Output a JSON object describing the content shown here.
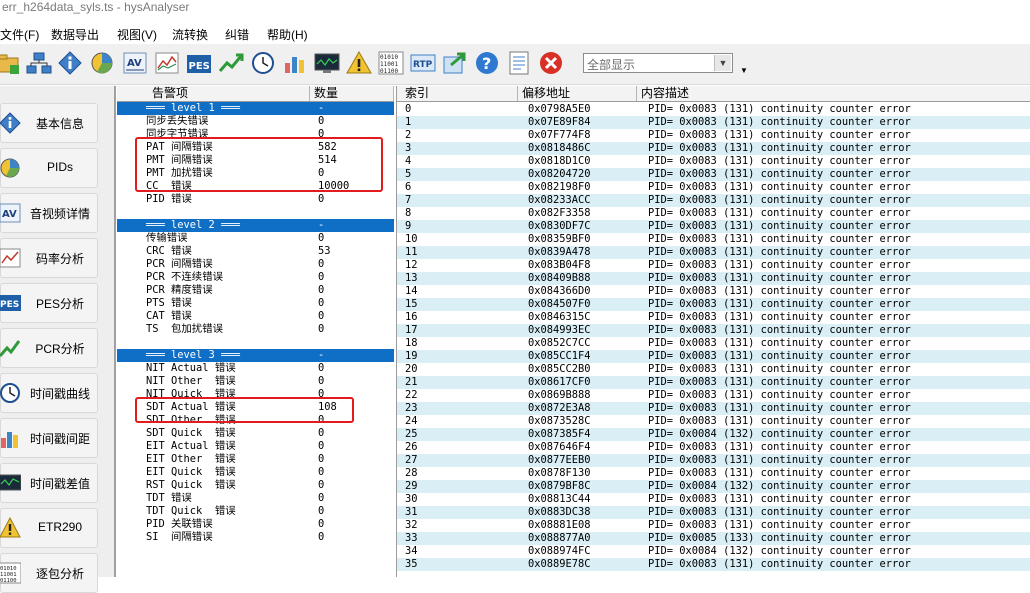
{
  "window": {
    "title": "err_h264data_syls.ts - hysAnalyser"
  },
  "menu": [
    {
      "label": "文件(F)"
    },
    {
      "label": "数据导出"
    },
    {
      "label": "视图(V)"
    },
    {
      "label": "流转换"
    },
    {
      "label": "纠错"
    },
    {
      "label": "帮助(H)"
    }
  ],
  "toolbar": {
    "buttons": [
      {
        "icon": "open-file-icon"
      },
      {
        "icon": "network-icon"
      },
      {
        "icon": "info-icon"
      },
      {
        "icon": "pie-chart-icon"
      },
      {
        "icon": "av-icon"
      },
      {
        "icon": "line-chart-icon"
      },
      {
        "icon": "pes-icon"
      },
      {
        "icon": "pcr-trend-icon"
      },
      {
        "icon": "clock-icon"
      },
      {
        "icon": "bar-chart-icon"
      },
      {
        "icon": "monitor-icon"
      },
      {
        "icon": "warning-icon"
      },
      {
        "icon": "binary-icon"
      },
      {
        "icon": "rtp-icon"
      },
      {
        "icon": "export-icon"
      },
      {
        "icon": "help-icon"
      },
      {
        "icon": "notes-icon"
      },
      {
        "icon": "close-icon"
      }
    ],
    "combo_value": "全部显示"
  },
  "sidebar": [
    {
      "label": "基本信息",
      "icon": "info-icon"
    },
    {
      "label": "PIDs",
      "icon": "pie-chart-icon"
    },
    {
      "label": "音视频详情",
      "icon": "av-icon"
    },
    {
      "label": "码率分析",
      "icon": "line-chart-icon"
    },
    {
      "label": "PES分析",
      "icon": "pes-icon"
    },
    {
      "label": "PCR分析",
      "icon": "pcr-trend-icon"
    },
    {
      "label": "时间戳曲线",
      "icon": "clock-icon"
    },
    {
      "label": "时间戳间距",
      "icon": "bar-chart-icon"
    },
    {
      "label": "时间戳差值",
      "icon": "monitor-icon"
    },
    {
      "label": "ETR290",
      "icon": "warning-icon"
    },
    {
      "label": "逐包分析",
      "icon": "binary-icon"
    }
  ],
  "alarms": {
    "headers": [
      "告警项",
      "数量"
    ],
    "rows": [
      {
        "label": "═══ level 1 ═══",
        "count": "-",
        "level": true
      },
      {
        "label": "同步丢失错误",
        "count": "0"
      },
      {
        "label": "同步字节错误",
        "count": "0"
      },
      {
        "label": "PAT 间隔错误",
        "count": "582"
      },
      {
        "label": "PMT 间隔错误",
        "count": "514"
      },
      {
        "label": "PMT 加扰错误",
        "count": "0"
      },
      {
        "label": "CC  错误",
        "count": "10000"
      },
      {
        "label": "PID 错误",
        "count": "0"
      },
      {
        "label": "",
        "count": ""
      },
      {
        "label": "═══ level 2 ═══",
        "count": "-",
        "level": true
      },
      {
        "label": "传输错误",
        "count": "0"
      },
      {
        "label": "CRC 错误",
        "count": "53"
      },
      {
        "label": "PCR 间隔错误",
        "count": "0"
      },
      {
        "label": "PCR 不连续错误",
        "count": "0"
      },
      {
        "label": "PCR 精度错误",
        "count": "0"
      },
      {
        "label": "PTS 错误",
        "count": "0"
      },
      {
        "label": "CAT 错误",
        "count": "0"
      },
      {
        "label": "TS  包加扰错误",
        "count": "0"
      },
      {
        "label": "",
        "count": ""
      },
      {
        "label": "═══ level 3 ═══",
        "count": "-",
        "level": true
      },
      {
        "label": "NIT Actual 错误",
        "count": "0"
      },
      {
        "label": "NIT Other  错误",
        "count": "0"
      },
      {
        "label": "NIT Quick  错误",
        "count": "0"
      },
      {
        "label": "SDT Actual 错误",
        "count": "108"
      },
      {
        "label": "SDT Other  错误",
        "count": "0"
      },
      {
        "label": "SDT Quick  错误",
        "count": "0"
      },
      {
        "label": "EIT Actual 错误",
        "count": "0"
      },
      {
        "label": "EIT Other  错误",
        "count": "0"
      },
      {
        "label": "EIT Quick  错误",
        "count": "0"
      },
      {
        "label": "RST Quick  错误",
        "count": "0"
      },
      {
        "label": "TDT 错误",
        "count": "0"
      },
      {
        "label": "TDT Quick  错误",
        "count": "0"
      },
      {
        "label": "PID 关联错误",
        "count": "0"
      },
      {
        "label": "SI  间隔错误",
        "count": "0"
      }
    ]
  },
  "detail": {
    "headers": [
      "索引",
      "偏移地址",
      "内容描述"
    ],
    "rows": [
      {
        "idx": "0",
        "off": "0x0798A5E0",
        "desc": "PID= 0x0083 (131) continuity counter error"
      },
      {
        "idx": "1",
        "off": "0x07E89F84",
        "desc": "PID= 0x0083 (131) continuity counter error"
      },
      {
        "idx": "2",
        "off": "0x07F774F8",
        "desc": "PID= 0x0083 (131) continuity counter error"
      },
      {
        "idx": "3",
        "off": "0x0818486C",
        "desc": "PID= 0x0083 (131) continuity counter error"
      },
      {
        "idx": "4",
        "off": "0x0818D1C0",
        "desc": "PID= 0x0083 (131) continuity counter error"
      },
      {
        "idx": "5",
        "off": "0x08204720",
        "desc": "PID= 0x0083 (131) continuity counter error"
      },
      {
        "idx": "6",
        "off": "0x082198F0",
        "desc": "PID= 0x0083 (131) continuity counter error"
      },
      {
        "idx": "7",
        "off": "0x08233ACC",
        "desc": "PID= 0x0083 (131) continuity counter error"
      },
      {
        "idx": "8",
        "off": "0x082F3358",
        "desc": "PID= 0x0083 (131) continuity counter error"
      },
      {
        "idx": "9",
        "off": "0x0830DF7C",
        "desc": "PID= 0x0083 (131) continuity counter error"
      },
      {
        "idx": "10",
        "off": "0x08359BF0",
        "desc": "PID= 0x0083 (131) continuity counter error"
      },
      {
        "idx": "11",
        "off": "0x0839A478",
        "desc": "PID= 0x0083 (131) continuity counter error"
      },
      {
        "idx": "12",
        "off": "0x083B04F8",
        "desc": "PID= 0x0083 (131) continuity counter error"
      },
      {
        "idx": "13",
        "off": "0x08409B88",
        "desc": "PID= 0x0083 (131) continuity counter error"
      },
      {
        "idx": "14",
        "off": "0x084366D0",
        "desc": "PID= 0x0083 (131) continuity counter error"
      },
      {
        "idx": "15",
        "off": "0x084507F0",
        "desc": "PID= 0x0083 (131) continuity counter error"
      },
      {
        "idx": "16",
        "off": "0x0846315C",
        "desc": "PID= 0x0083 (131) continuity counter error"
      },
      {
        "idx": "17",
        "off": "0x084993EC",
        "desc": "PID= 0x0083 (131) continuity counter error"
      },
      {
        "idx": "18",
        "off": "0x0852C7CC",
        "desc": "PID= 0x0083 (131) continuity counter error"
      },
      {
        "idx": "19",
        "off": "0x085CC1F4",
        "desc": "PID= 0x0083 (131) continuity counter error"
      },
      {
        "idx": "20",
        "off": "0x085CC2B0",
        "desc": "PID= 0x0083 (131) continuity counter error"
      },
      {
        "idx": "21",
        "off": "0x08617CF0",
        "desc": "PID= 0x0083 (131) continuity counter error"
      },
      {
        "idx": "22",
        "off": "0x0869B888",
        "desc": "PID= 0x0083 (131) continuity counter error"
      },
      {
        "idx": "23",
        "off": "0x0872E3A8",
        "desc": "PID= 0x0083 (131) continuity counter error"
      },
      {
        "idx": "24",
        "off": "0x0873528C",
        "desc": "PID= 0x0083 (131) continuity counter error"
      },
      {
        "idx": "25",
        "off": "0x087385F4",
        "desc": "PID= 0x0084 (132) continuity counter error"
      },
      {
        "idx": "26",
        "off": "0x087646F4",
        "desc": "PID= 0x0083 (131) continuity counter error"
      },
      {
        "idx": "27",
        "off": "0x0877EEB0",
        "desc": "PID= 0x0083 (131) continuity counter error"
      },
      {
        "idx": "28",
        "off": "0x0878F130",
        "desc": "PID= 0x0083 (131) continuity counter error"
      },
      {
        "idx": "29",
        "off": "0x0879BF8C",
        "desc": "PID= 0x0084 (132) continuity counter error"
      },
      {
        "idx": "30",
        "off": "0x08813C44",
        "desc": "PID= 0x0083 (131) continuity counter error"
      },
      {
        "idx": "31",
        "off": "0x0883DC38",
        "desc": "PID= 0x0083 (131) continuity counter error"
      },
      {
        "idx": "32",
        "off": "0x08881E08",
        "desc": "PID= 0x0083 (131) continuity counter error"
      },
      {
        "idx": "33",
        "off": "0x088877A0",
        "desc": "PID= 0x0085 (133) continuity counter error"
      },
      {
        "idx": "34",
        "off": "0x088974FC",
        "desc": "PID= 0x0084 (132) continuity counter error"
      },
      {
        "idx": "35",
        "off": "0x0889E78C",
        "desc": "PID= 0x0083 (131) continuity counter error"
      }
    ]
  },
  "colors": {
    "level_band": "#0f6fc6",
    "alt_row": "#d9eef5",
    "highlight_box": "#e21c1c"
  }
}
